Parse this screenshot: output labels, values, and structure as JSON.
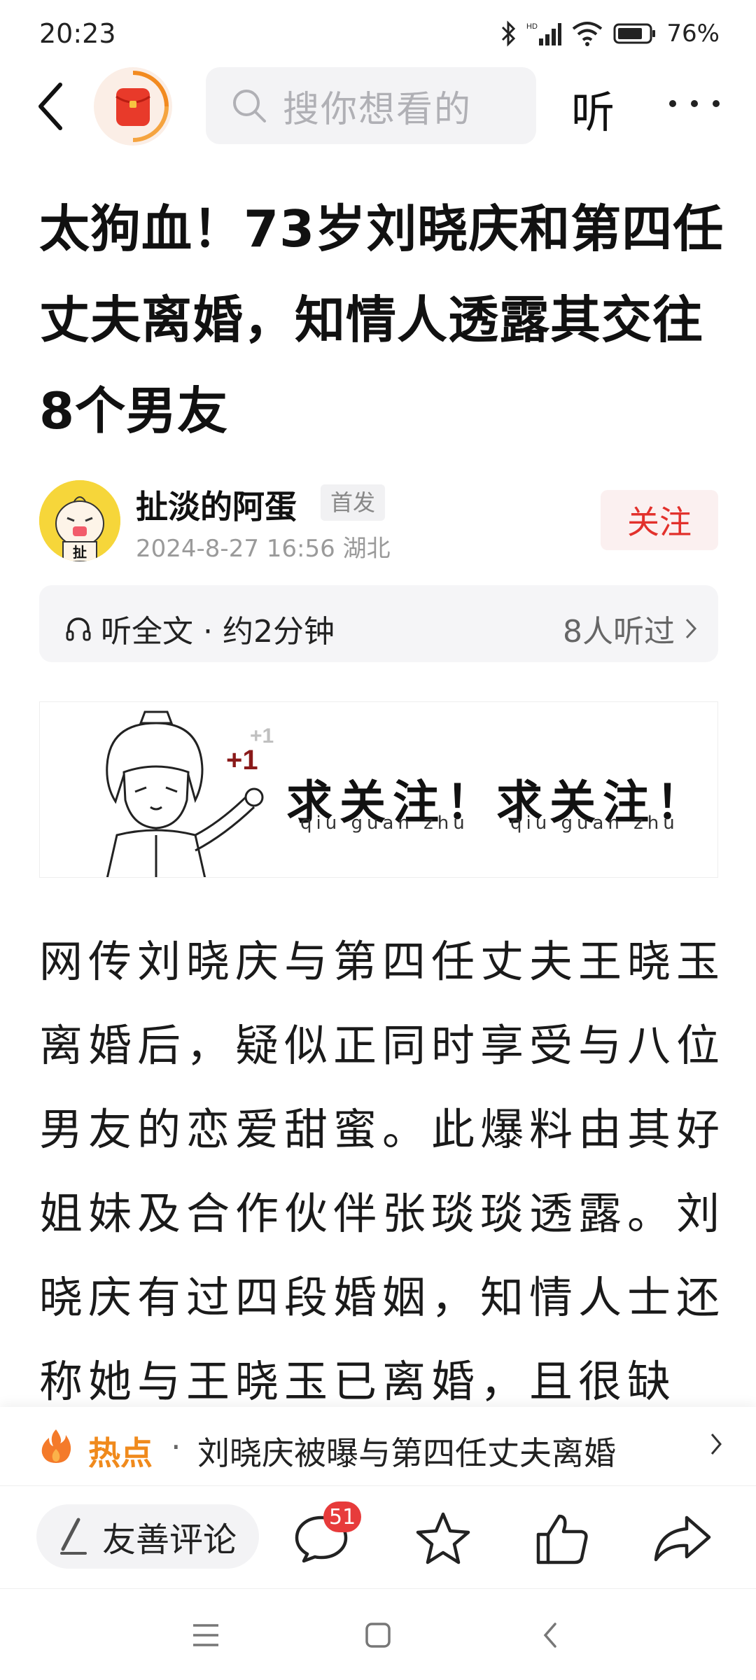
{
  "status_bar": {
    "time": "20:23",
    "battery": "76%"
  },
  "top_nav": {
    "search_placeholder": "搜你想看的",
    "listen_label": "听"
  },
  "article": {
    "title": "太狗血！73岁刘晓庆和第四任丈夫离婚，知情人透露其交往8个男友",
    "author": {
      "name": "扯淡的阿蛋",
      "badge": "首发",
      "date": "2024-8-27",
      "time": "16:56",
      "location": "湖北",
      "avatar_char": "扯"
    },
    "follow_label": "关注",
    "listen_bar": {
      "label": "听全文 · 约2分钟",
      "count": "8人听过"
    },
    "banner": {
      "text_left": "求关注！",
      "text_right": "求关注！",
      "pinyin": "qiu guan zhu"
    },
    "body": "网传刘晓庆与第四任丈夫王晓玉离婚后，疑似正同时享受与八位男友的恋爱甜蜜。此爆料由其好姐妹及合作伙伴张琰琰透露。刘晓庆有过四段婚姻，知情人士还称她与王晓玉已离婚，且很缺"
  },
  "hot_topic": {
    "label": "热点",
    "separator": "·",
    "text": "刘晓庆被曝与第四任丈夫离婚"
  },
  "action_bar": {
    "comment_placeholder": "友善评论",
    "comment_count": "51"
  },
  "colors": {
    "accent_red": "#e2312c",
    "hot_orange": "#f08a1c",
    "badge_red": "#e73b3b"
  }
}
